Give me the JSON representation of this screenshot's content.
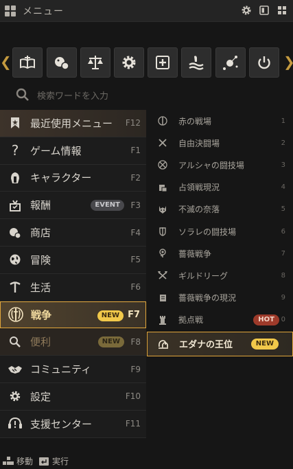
{
  "window": {
    "title": "メニュー"
  },
  "toolbar": {
    "buttons": [
      {
        "icon": "book-sword-icon"
      },
      {
        "icon": "shop-icon"
      },
      {
        "icon": "scales-icon"
      },
      {
        "icon": "gear-icon"
      },
      {
        "icon": "plus-box-icon"
      },
      {
        "icon": "hand-wave-icon"
      },
      {
        "icon": "constellation-icon"
      },
      {
        "icon": "power-icon"
      }
    ]
  },
  "search": {
    "placeholder": "検索ワードを入力"
  },
  "left_menu": {
    "items": [
      {
        "label": "最近使用メニュー",
        "key": "F12",
        "icon": "bookmark-icon"
      },
      {
        "label": "ゲーム情報",
        "key": "F1",
        "icon": "question-icon"
      },
      {
        "label": "キャラクター",
        "key": "F2",
        "icon": "helmet-icon"
      },
      {
        "label": "報酬",
        "key": "F3",
        "icon": "gift-icon",
        "badge": "EVENT"
      },
      {
        "label": "商店",
        "key": "F4",
        "icon": "shop-icon"
      },
      {
        "label": "冒険",
        "key": "F5",
        "icon": "globe-icon"
      },
      {
        "label": "生活",
        "key": "F6",
        "icon": "pickaxe-icon"
      },
      {
        "label": "戦争",
        "key": "F7",
        "icon": "war-shield-icon",
        "badge": "NEW"
      },
      {
        "label": "便利",
        "key": "F8",
        "icon": "magnifier-icon",
        "badge": "NEW"
      },
      {
        "label": "コミュニティ",
        "key": "F9",
        "icon": "handshake-icon"
      },
      {
        "label": "設定",
        "key": "F10",
        "icon": "gear-icon"
      },
      {
        "label": "支援センター",
        "key": "F11",
        "icon": "support-icon"
      }
    ]
  },
  "right_menu": {
    "items": [
      {
        "label": "赤の戦場",
        "num": "1",
        "icon": "war-shield-icon"
      },
      {
        "label": "自由決闘場",
        "num": "2",
        "icon": "crossed-swords-icon"
      },
      {
        "label": "アルシャの闘技場",
        "num": "3",
        "icon": "arena-icon"
      },
      {
        "label": "占領戦現況",
        "num": "4",
        "icon": "castle-report-icon"
      },
      {
        "label": "不滅の奈落",
        "num": "5",
        "icon": "demon-icon"
      },
      {
        "label": "ソラレの闘技場",
        "num": "6",
        "icon": "sword-shield-icon"
      },
      {
        "label": "薔薇戦争",
        "num": "7",
        "icon": "rose-icon"
      },
      {
        "label": "ギルドリーグ",
        "num": "8",
        "icon": "guild-axes-icon"
      },
      {
        "label": "薔薇戦争の現況",
        "num": "9",
        "icon": "scroll-icon"
      },
      {
        "label": "拠点戦",
        "num": "0",
        "icon": "tower-icon",
        "badge": "HOT"
      },
      {
        "label": "エダナの王位",
        "icon": "throne-icon",
        "badge": "NEW"
      }
    ]
  },
  "footer": {
    "move_label": "移動",
    "execute_label": "実行"
  },
  "colors": {
    "accent": "#e2a63a",
    "new_badge": "#f1c84a",
    "hot_badge": "#9d3a2a",
    "event_badge": "#48484c",
    "background": "#161616"
  }
}
